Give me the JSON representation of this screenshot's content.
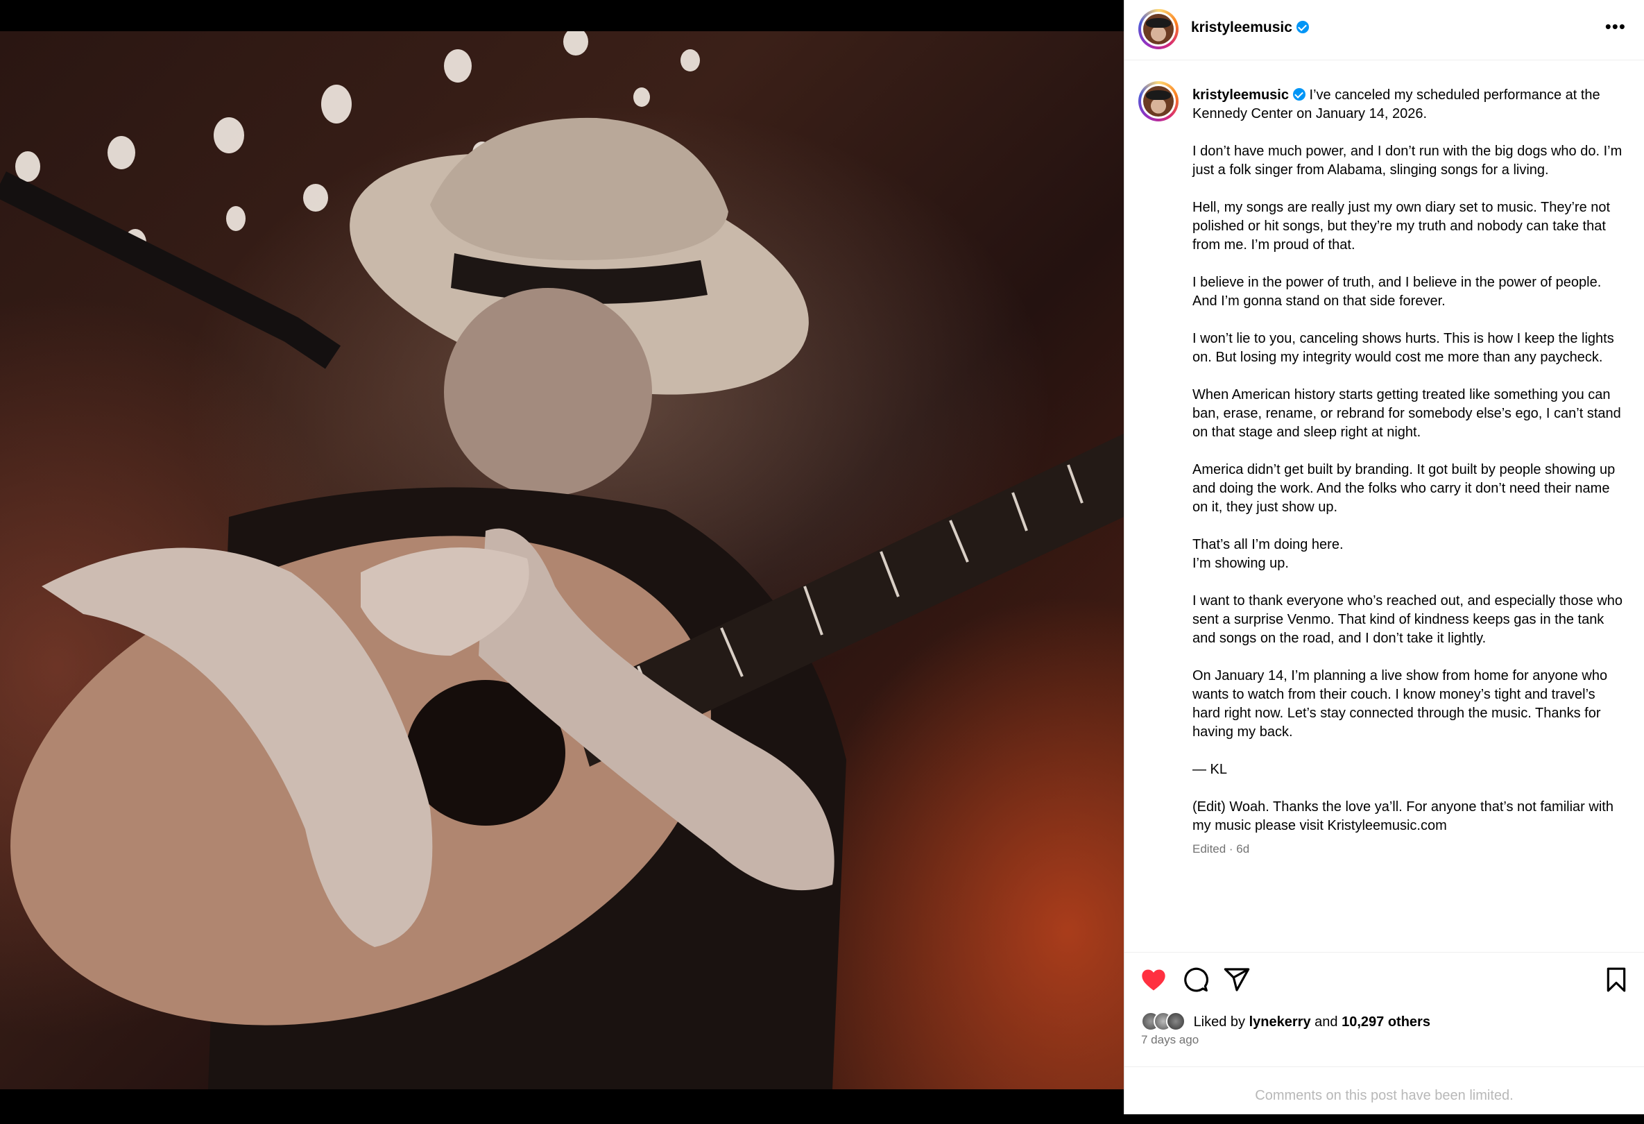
{
  "post": {
    "username": "kristyleemusic",
    "caption_first": "I’ve canceled my scheduled performance at the Kennedy Center on January 14, 2026.",
    "caption_paragraphs": [
      "I don’t have much power, and I don’t run with the big dogs who do. I’m just a folk singer from Alabama, slinging songs for a living.",
      "Hell, my songs are really just my own diary set to music. They’re not polished or hit songs, but they’re my truth and nobody can take that from me. I’m proud of that.",
      "I believe in the power of truth, and I believe in the power of people. And I’m gonna stand on that side forever.",
      "I won’t lie to you, canceling shows hurts. This is how I keep the lights on. But losing my integrity would cost me more than any paycheck.",
      "When American history starts getting treated like something you can ban, erase, rename, or rebrand for somebody else’s ego, I can’t stand on that stage and sleep right at night.",
      "America didn’t get built by branding. It got built by people showing up and doing the work. And the folks who carry it don’t need their name on it, they just show up.",
      "That’s all I’m doing here.\nI’m showing up.",
      "I want to thank everyone who’s reached out, and especially those who sent a surprise Venmo. That kind of kindness keeps gas in the tank and songs on the road, and I don’t take it lightly.",
      "On January 14, I’m planning a live show from home for anyone who wants to watch from their couch. I know money’s tight and travel’s hard right now. Let’s stay connected through the music. Thanks for having my back.",
      "— KL",
      "(Edit) Woah. Thanks the love ya’ll. For anyone that’s not familiar with my music please visit Kristyleemusic.com"
    ],
    "meta": "Edited · 6d",
    "likes_prefix": "Liked by",
    "likes_user": "lynekerry",
    "likes_and": "and",
    "likes_others": "10,297 others",
    "date": "7 days ago",
    "comments_notice": "Comments on this post have been limited.",
    "liked": true
  },
  "icons": {
    "more": "more-options-icon",
    "heart": "heart-icon",
    "comment": "comment-icon",
    "share": "share-icon",
    "bookmark": "bookmark-icon",
    "verified": "verified-badge-icon"
  },
  "colors": {
    "heart": "#ff3040",
    "verified": "#0095f6",
    "muted": "#737373"
  }
}
